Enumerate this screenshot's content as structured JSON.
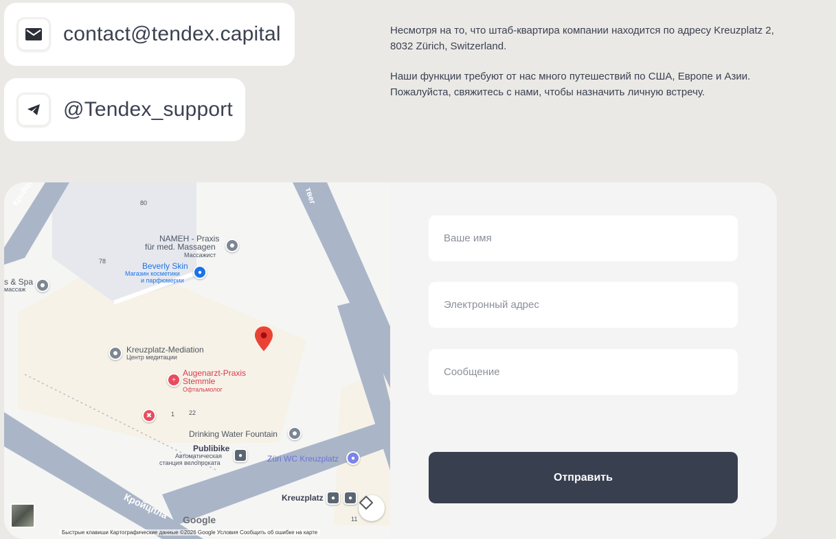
{
  "contacts": {
    "email": "contact@tendex.capital",
    "telegram": "@Tendex_support"
  },
  "info": {
    "paragraph1": "Несмотря на то, что штаб-квартира компании находится по адресу Kreuzplatz 2, 8032 Zürich, Switzerland.",
    "paragraph2": "Наши функции требуют от нас много путешествий по США, Европе и Азии. Пожалуйста, свяжитесь с нами, чтобы назначить личную встречу."
  },
  "map": {
    "street_top_left": "Кройцштрасс",
    "street_top_right": "твег",
    "street_bottom": "Кройцпла",
    "numbers": [
      "80",
      "78",
      "1",
      "22",
      "11"
    ],
    "pois": {
      "nameh": "NAMEH - Praxis",
      "nameh_line2": "für med. Massagen",
      "nameh_sub": "Массажист",
      "beverly": "Beverly Skin",
      "beverly_sub1": "Магазин косметики",
      "beverly_sub2": "и парфюмерии",
      "spa": "s & Spa",
      "spa_sub": "массаж",
      "mediation": "Kreuzplatz-Mediation",
      "mediation_sub": "Центр медитации",
      "augen": "Augenarzt-Praxis",
      "augen_line2": "Stemmle",
      "augen_sub": "Офтальмолог",
      "fountain": "Drinking Water Fountain",
      "publibike": "Publibike",
      "publibike_sub1": "Автоматическая",
      "publibike_sub2": "станция велопроката",
      "wc": "Züri WC Kreuzplatz",
      "kreuzplatz": "Kreuzplatz"
    },
    "google": "Google",
    "footer": "Быстрые клавиши    Картографические данные ©2026 Google    Условия    Сообщить об ошибке на карте"
  },
  "form": {
    "name_placeholder": "Ваше имя",
    "email_placeholder": "Электронный адрес",
    "message_placeholder": "Сообщение",
    "submit_label": "Отправить"
  },
  "icons": {
    "email": "envelope-icon",
    "telegram": "telegram-icon",
    "marker": "map-pin-icon",
    "fullscreen": "fullscreen-icon"
  },
  "colors": {
    "background": "#ebe9e6",
    "button": "#383f4f",
    "text": "#3a4150",
    "marker": "#ea4335"
  }
}
